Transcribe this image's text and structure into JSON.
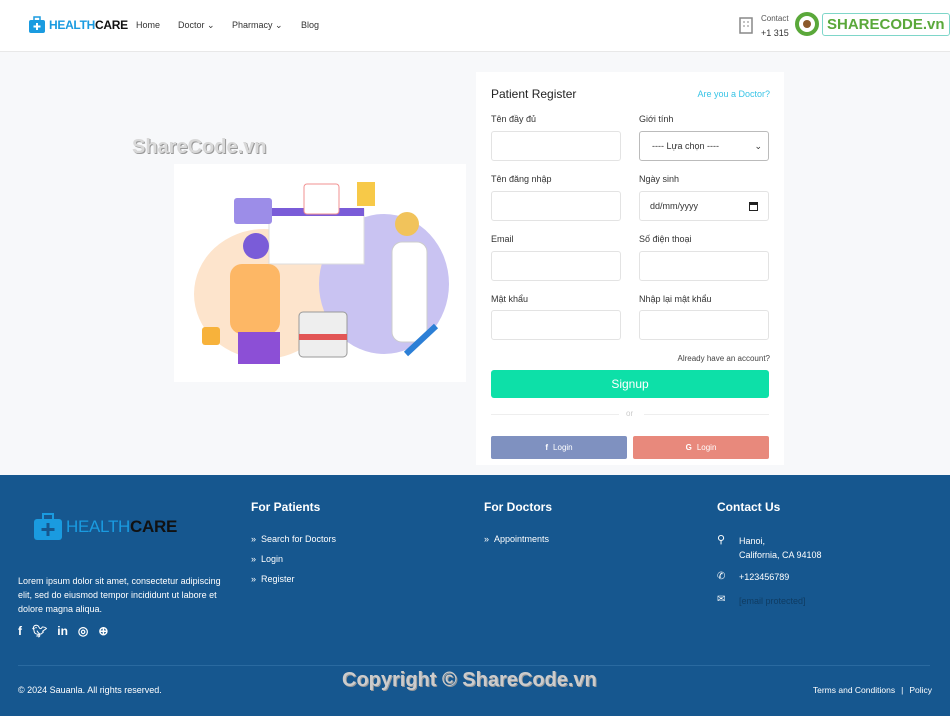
{
  "header": {
    "logo_a": "HEALTH",
    "logo_b": "CARE",
    "nav": [
      "Home",
      "Doctor",
      "Pharmacy",
      "Blog"
    ],
    "contact_label": "Contact",
    "contact_phone": "+1 315",
    "watermark_logo": "SHARECODE.vn"
  },
  "watermark": "ShareCode.vn",
  "form": {
    "title": "Patient Register",
    "doctor_link": "Are you a Doctor?",
    "fields": [
      {
        "label": "Tên đầy đủ",
        "value": ""
      },
      {
        "label": "Giới tính",
        "value": "---- Lựa chọn ----"
      },
      {
        "label": "Tên đăng nhập",
        "value": ""
      },
      {
        "label": "Ngày sinh",
        "value": "dd/mm/yyyy"
      },
      {
        "label": "Email",
        "value": ""
      },
      {
        "label": "Số điện thoại",
        "value": ""
      },
      {
        "label": "Mật khẩu",
        "value": ""
      },
      {
        "label": "Nhập lại mật khẩu",
        "value": ""
      }
    ],
    "have_account": "Already have an account?",
    "signup": "Signup",
    "or": "or",
    "facebook_login": "Login",
    "google_login": "Login"
  },
  "colors": {
    "accent": "#0de0a8",
    "footer": "#16578f",
    "facebook": "#7f91c0",
    "google": "#e8897c",
    "link": "#38c4e6"
  },
  "footer": {
    "logo_a": "HEALTH",
    "logo_b": "CARE",
    "about": "Lorem ipsum dolor sit amet, consectetur adipiscing elit, sed do eiusmod tempor incididunt ut labore et dolore magna aliqua.",
    "patients_title": "For Patients",
    "patients_links": [
      "Search for Doctors",
      "Login",
      "Register"
    ],
    "doctors_title": "For Doctors",
    "doctors_links": [
      "Appointments"
    ],
    "contact_title": "Contact Us",
    "address1": "Hanoi,",
    "address2": "California, CA 94108",
    "phone": "+123456789",
    "email": "[email protected]",
    "copyright": "© 2024 Sauanla. All rights reserved.",
    "watermark": "Copyright © ShareCode.vn",
    "terms": "Terms and Conditions",
    "sep": "|",
    "policy": "Policy"
  }
}
